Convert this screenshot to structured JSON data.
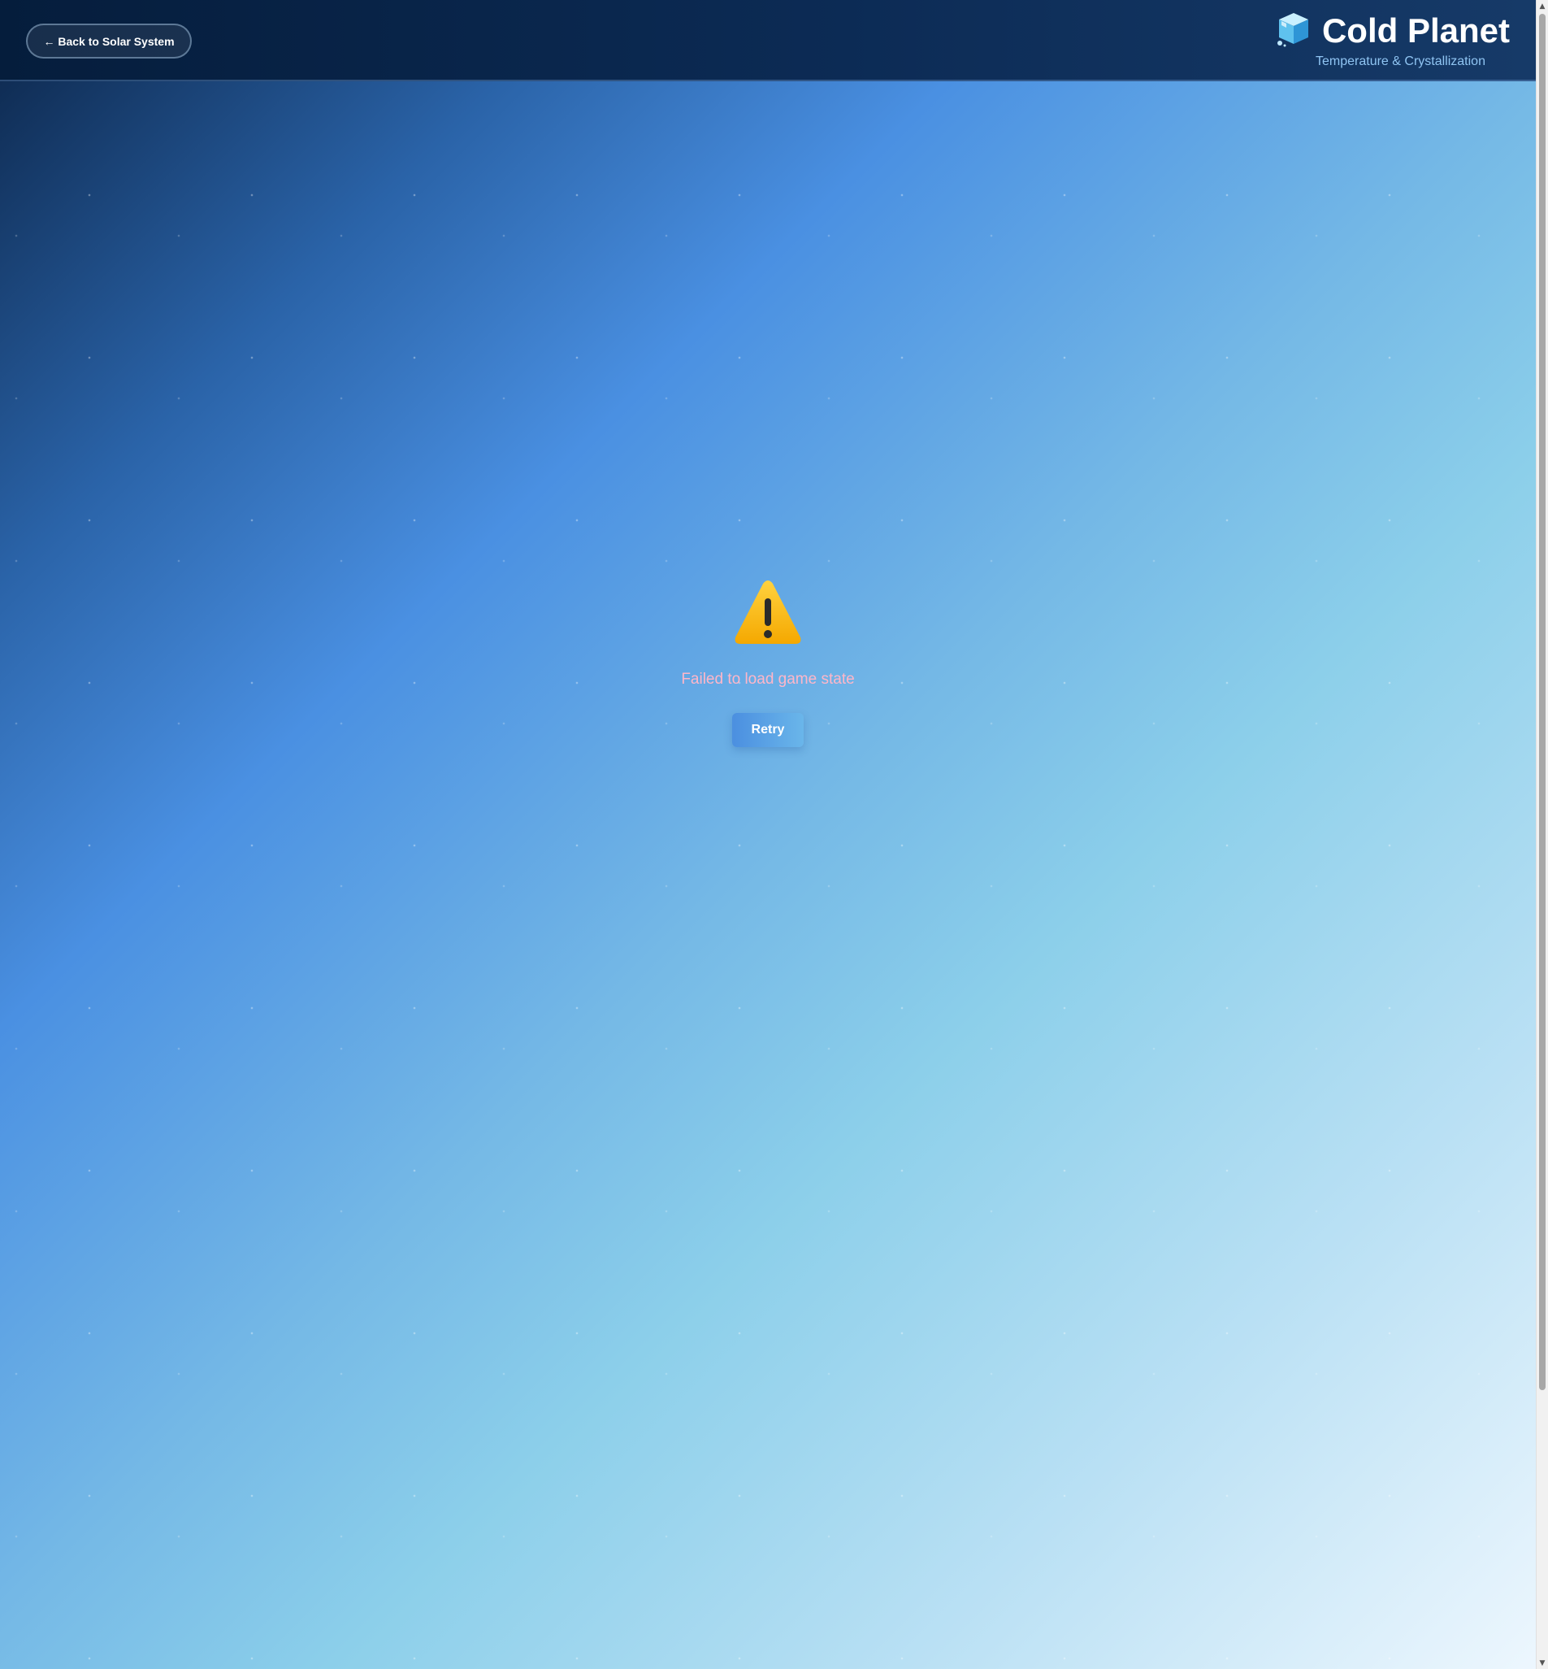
{
  "header": {
    "back_label": "← Back to Solar System",
    "title": "Cold Planet",
    "subtitle": "Temperature & Crystallization",
    "logo_icon": "ice-cube-icon"
  },
  "error": {
    "icon": "warning-icon",
    "message": "Failed to load game state",
    "retry_label": "Retry"
  },
  "colors": {
    "header_bg": "#0c2b55",
    "error_text": "#ffb6c8",
    "retry_bg": "#4b8fe0"
  }
}
